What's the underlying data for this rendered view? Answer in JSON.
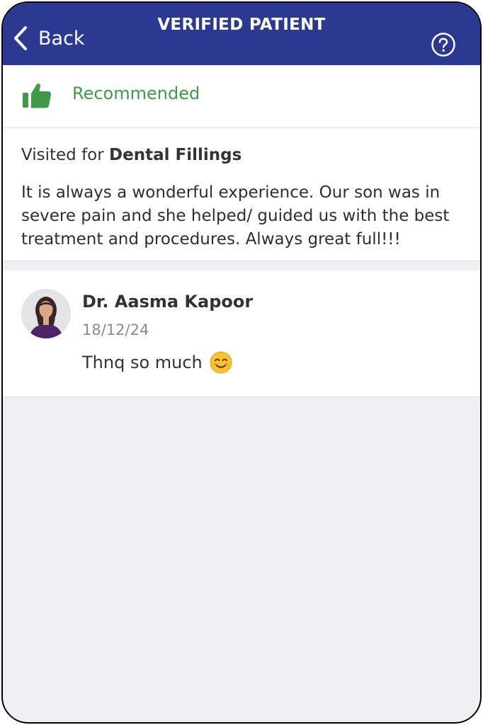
{
  "header": {
    "back_label": "Back",
    "title": "VERIFIED PATIENT",
    "help_icon": "question-circle-icon",
    "background": "#2b3990"
  },
  "recommendation": {
    "icon": "thumbs-up-icon",
    "label": "Recommended",
    "color": "#3e9a47"
  },
  "review": {
    "visited_prefix": "Visited for",
    "treatment": "Dental Fillings",
    "text": "It is always a wonderful experience.  Our son was in severe pain and she helped/ guided us with the best treatment and procedures. Always great full!!!"
  },
  "reply": {
    "doctor_name": "Dr. Aasma Kapoor",
    "date": "18/12/24",
    "text": "Thnq so much",
    "emoji_icon": "smiling-face-emoji"
  }
}
